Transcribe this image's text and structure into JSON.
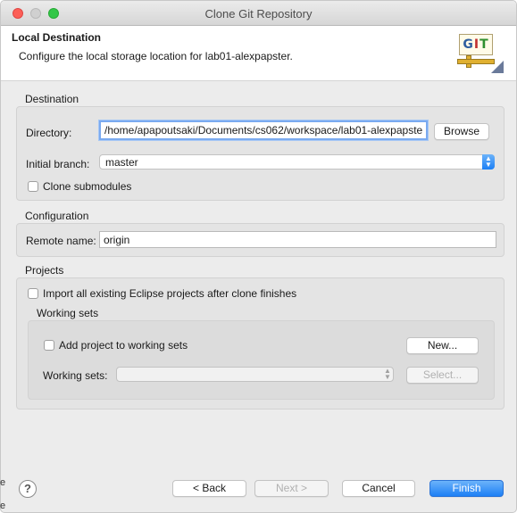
{
  "window": {
    "title": "Clone Git Repository"
  },
  "header": {
    "title": "Local Destination",
    "description": "Configure the local storage location for lab01-alexpapster.",
    "logo_text": [
      "G",
      "I",
      "T"
    ]
  },
  "destination": {
    "group_label": "Destination",
    "directory_label": "Directory:",
    "directory_value": "/home/apapoutsaki/Documents/cs062/workspace/lab01-alexpapste",
    "browse_label": "Browse",
    "branch_label": "Initial branch:",
    "branch_value": "master",
    "clone_submodules_label": "Clone submodules"
  },
  "configuration": {
    "group_label": "Configuration",
    "remote_name_label": "Remote name:",
    "remote_name_value": "origin"
  },
  "projects": {
    "group_label": "Projects",
    "import_label": "Import all existing Eclipse projects after clone finishes",
    "working_sets": {
      "group_label": "Working sets",
      "add_label": "Add project to working sets",
      "new_label": "New...",
      "sets_label": "Working sets:",
      "sets_value": "",
      "select_label": "Select..."
    }
  },
  "footer": {
    "help_icon": "?",
    "back_label": "< Back",
    "next_label": "Next >",
    "cancel_label": "Cancel",
    "finish_label": "Finish"
  },
  "edge_text": [
    "e",
    "e"
  ],
  "colors": {
    "accent": "#1d7ff5",
    "close": "#fc5f57",
    "maximize": "#33c748"
  }
}
